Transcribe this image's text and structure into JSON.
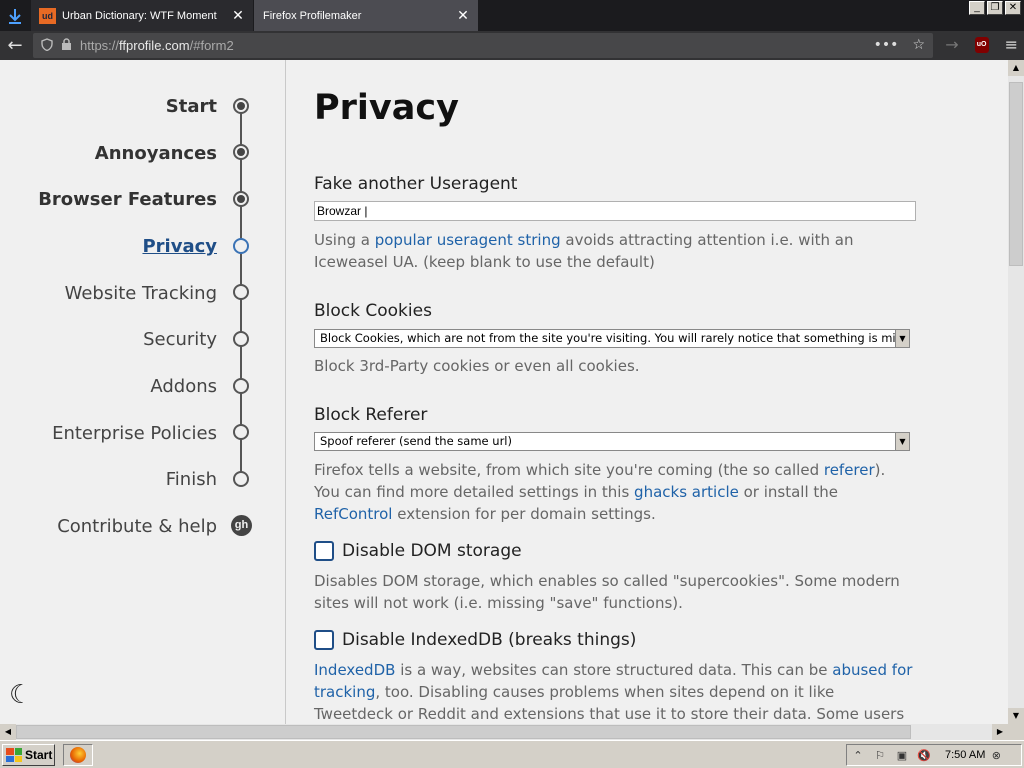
{
  "browser": {
    "tabs": [
      {
        "label": "Urban Dictionary: WTF Moment",
        "favicon": "ud",
        "active": false
      },
      {
        "label": "Firefox Profilemaker",
        "active": true
      }
    ],
    "url_scheme": "https://",
    "url_domain": "ffprofile.com",
    "url_path": "/#form2",
    "ublock_label": "uO"
  },
  "sidebar": {
    "steps": [
      {
        "label": "Start",
        "state": "done"
      },
      {
        "label": "Annoyances",
        "state": "done"
      },
      {
        "label": "Browser Features",
        "state": "done"
      },
      {
        "label": "Privacy",
        "state": "active"
      },
      {
        "label": "Website Tracking",
        "state": "todo"
      },
      {
        "label": "Security",
        "state": "todo"
      },
      {
        "label": "Addons",
        "state": "todo"
      },
      {
        "label": "Enterprise Policies",
        "state": "todo"
      },
      {
        "label": "Finish",
        "state": "todo"
      }
    ],
    "contribute": "Contribute & help"
  },
  "main": {
    "heading": "Privacy",
    "useragent": {
      "label": "Fake another Useragent",
      "value": "Browzar |",
      "desc_pre": "Using a ",
      "desc_link": "popular useragent string",
      "desc_post": " avoids attracting attention i.e. with an Iceweasel UA. (keep blank to use the default)"
    },
    "cookies": {
      "label": "Block Cookies",
      "selected": "Block Cookies, which are not from the site you're visiting. You will rarely notice that something is missing",
      "desc": "Block 3rd-Party cookies or even all cookies."
    },
    "referer": {
      "label": "Block Referer",
      "selected": "Spoof referer (send the same url)",
      "desc_1": "Firefox tells a website, from which site you're coming (the so called ",
      "link_1": "referer",
      "desc_2": "). You can find more detailed settings in this ",
      "link_2": "ghacks article",
      "desc_3": " or install the ",
      "link_3": "RefControl",
      "desc_4": " extension for per domain settings."
    },
    "dom_storage": {
      "label": "Disable DOM storage",
      "checked": false,
      "desc": "Disables DOM storage, which enables so called \"supercookies\". Some modern sites will not work (i.e. missing \"save\" functions)."
    },
    "indexeddb": {
      "label": "Disable IndexedDB (breaks things)",
      "checked": false,
      "link_1": "IndexedDB",
      "desc_1": " is a way, websites can store structured data. This can be ",
      "link_2": "abused for tracking",
      "desc_2": ", too. Disabling causes problems when sites depend on it like Tweetdeck or Reddit and extensions that use it to store their data. Some users reported"
    }
  },
  "taskbar": {
    "start_label": "Start",
    "clock": "7:50 AM"
  },
  "colors": {
    "accent": "#1f4e87",
    "link": "#1f62a8"
  }
}
